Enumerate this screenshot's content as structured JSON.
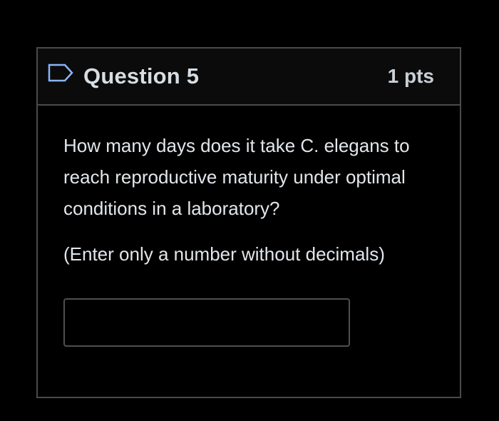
{
  "question": {
    "title": "Question 5",
    "points": "1 pts",
    "flag_icon": "flag-outline-icon",
    "text": "How many days does it take C. elegans to reach reproductive maturity under optimal conditions in a laboratory?",
    "instruction": "(Enter only a number without decimals)",
    "answer": {
      "value": "",
      "placeholder": ""
    }
  },
  "colors": {
    "background": "#000000",
    "border": "#4a4a4a",
    "text": "#e2e6ea"
  }
}
